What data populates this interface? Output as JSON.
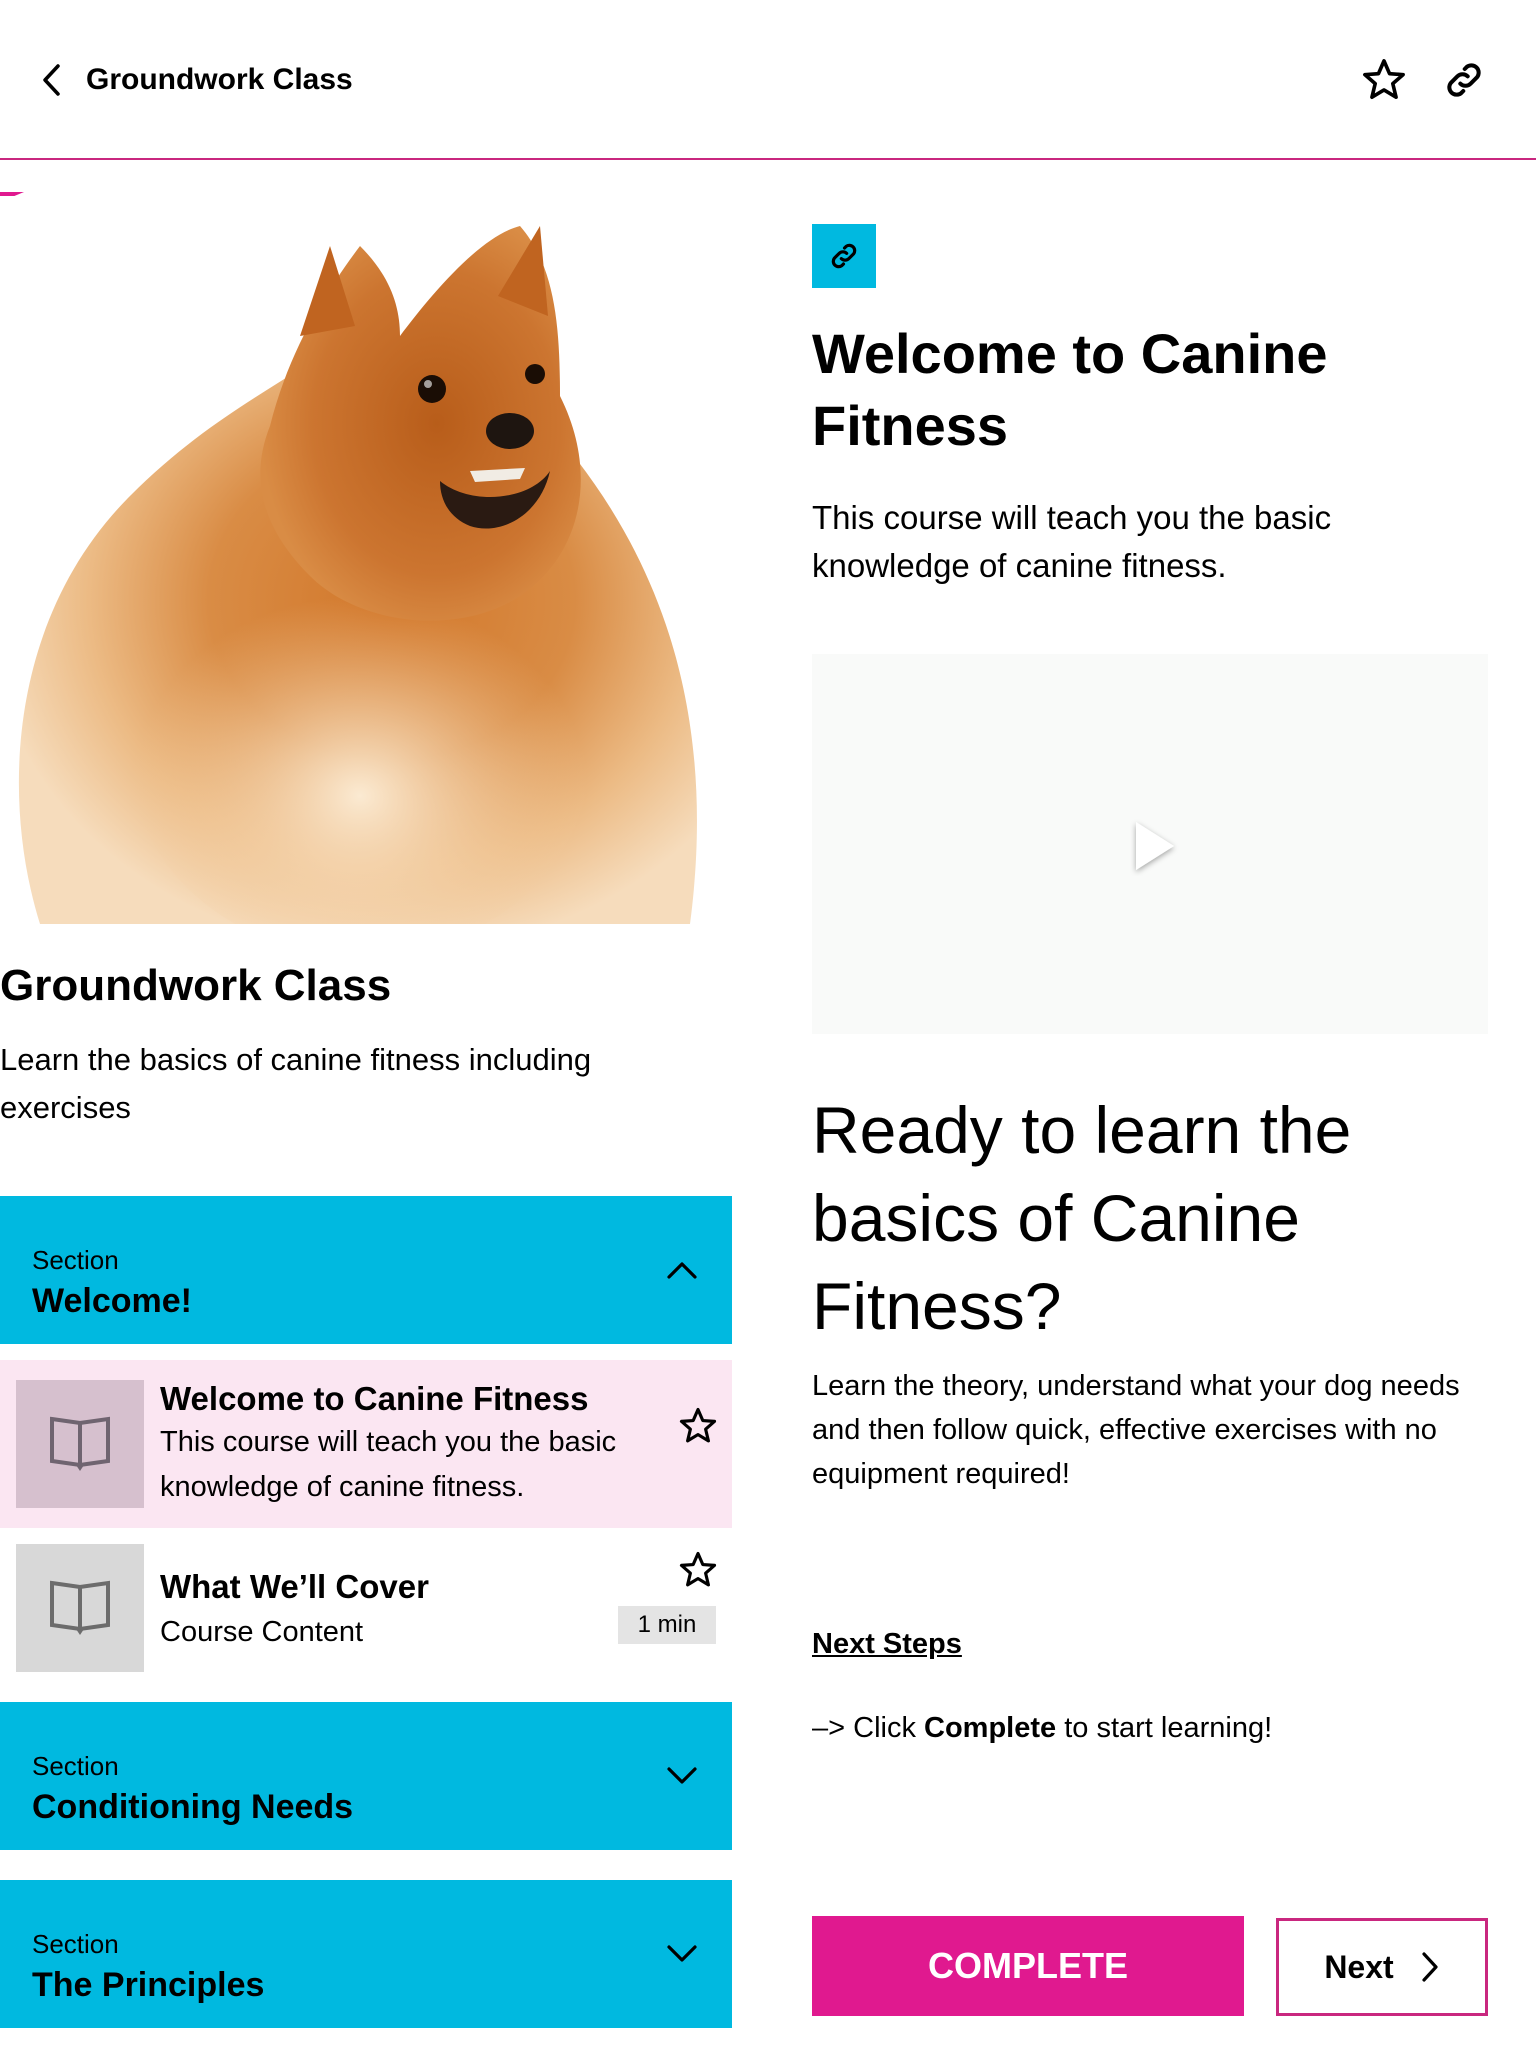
{
  "header": {
    "back_icon": "chevron-left-icon",
    "title": "Groundwork Class",
    "actions": [
      {
        "icon": "star-outline-icon",
        "label": "Favorite"
      },
      {
        "icon": "link-icon",
        "label": "Copy link"
      }
    ]
  },
  "colors": {
    "accent_magenta": "#e0198f",
    "section_blue": "#00b9e0",
    "active_row_pink": "#fbe6f2",
    "header_rule": "#c9277f"
  },
  "course": {
    "hero_image": "Pomeranian dog photo",
    "title": "Groundwork Class",
    "description": "Learn the basics of canine fitness including exercises"
  },
  "sections": [
    {
      "label": "Section",
      "name": "Welcome!",
      "expanded": true,
      "chevron_icon": "chevron-up-icon",
      "lessons": [
        {
          "icon": "book-open-icon",
          "title": "Welcome to Canine Fitness",
          "subtitle": "This course will teach you the basic knowledge of canine fitness.",
          "active": true,
          "favorite_icon": "star-outline-icon"
        },
        {
          "icon": "book-open-icon",
          "title": "What We’ll Cover",
          "subtitle": "Course Content",
          "duration": "1 min",
          "active": false,
          "favorite_icon": "star-outline-icon"
        }
      ]
    },
    {
      "label": "Section",
      "name": "Conditioning Needs",
      "expanded": false,
      "chevron_icon": "chevron-down-icon"
    },
    {
      "label": "Section",
      "name": "The Principles",
      "expanded": false,
      "chevron_icon": "chevron-down-icon"
    }
  ],
  "lesson": {
    "type_icon": "link-icon",
    "title": "Welcome to Canine Fitness",
    "intro": "This course will teach you the basic knowledge of canine fitness.",
    "video": {
      "play_icon": "play-icon"
    },
    "ready_heading": "Ready to learn the basics of Canine Fitness?",
    "ready_body": "Learn the theory, understand what your dog needs and then follow quick, effective exercises with no equipment required!",
    "next_steps_heading": "Next Steps",
    "instruction_prefix": "–> Click ",
    "instruction_bold": "Complete",
    "instruction_suffix": " to start learning!"
  },
  "footer": {
    "complete_label": "COMPLETE",
    "next_label": "Next",
    "next_icon": "chevron-right-icon"
  }
}
